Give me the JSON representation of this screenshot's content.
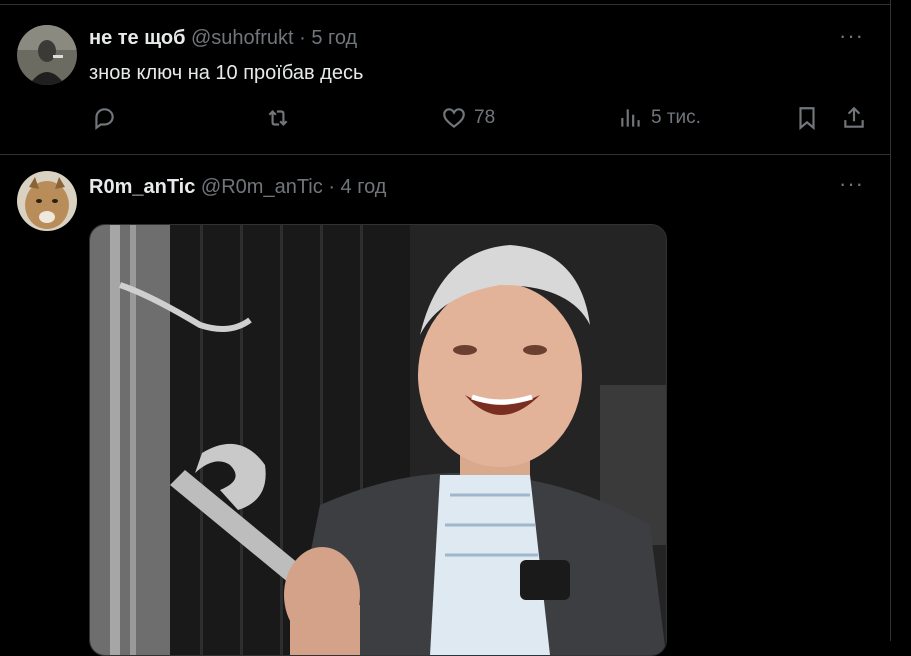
{
  "tweets": [
    {
      "display_name": "не те щоб",
      "handle": "@suhofrukt",
      "time": "· 5 год",
      "text": "знов ключ на 10 проїбав десь",
      "more": "···",
      "likes": "78",
      "views": "5 тис."
    },
    {
      "display_name": "R0m_anTic",
      "handle": "@R0m_anTic",
      "time": "· 4 год",
      "more": "···"
    }
  ],
  "colors": {
    "background": "#000000",
    "text": "#e7e9ea",
    "muted": "#71767b",
    "border": "#2f3336"
  },
  "icons": [
    "reply-icon",
    "retweet-icon",
    "like-icon",
    "views-icon",
    "bookmark-icon",
    "share-icon",
    "more-icon"
  ]
}
